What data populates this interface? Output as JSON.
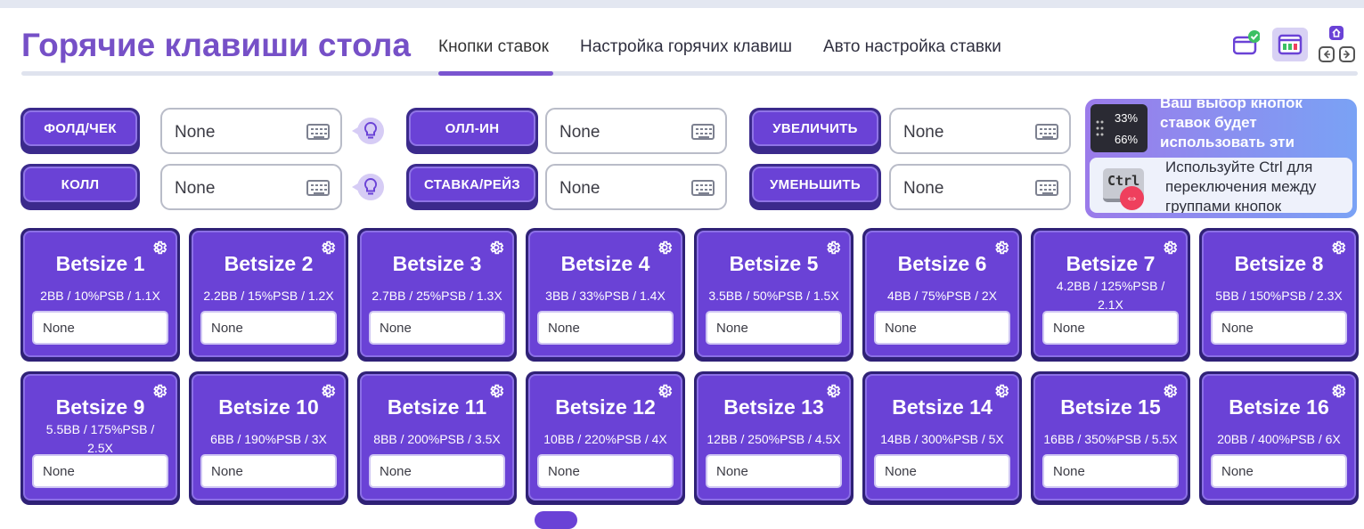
{
  "header": {
    "title": "Горячие клавиши стола",
    "tabs": [
      {
        "label": "Кнопки ставок",
        "active": true
      },
      {
        "label": "Настройка горячих клавиш",
        "active": false
      },
      {
        "label": "Авто настройка ставки",
        "active": false
      }
    ]
  },
  "actions": {
    "fold_check": {
      "label": "ФОЛД/ЧЕК",
      "value": "None"
    },
    "call": {
      "label": "КОЛЛ",
      "value": "None"
    },
    "all_in": {
      "label": "ОЛЛ-ИН",
      "value": "None"
    },
    "bet_raise": {
      "label": "СТАВКА/РЕЙЗ",
      "value": "None"
    },
    "increase": {
      "label": "УВЕЛИЧИТЬ",
      "value": "None"
    },
    "decrease": {
      "label": "УМЕНЬШИТЬ",
      "value": "None"
    }
  },
  "tips": {
    "pct_top": "33%",
    "pct_bottom": "66%",
    "tip1_text": "Ваш выбор кнопок ставок будет использовать эти",
    "ctrl_key": "Ctrl",
    "tip2_text": "Используйте Ctrl для переключения между группами кнопок"
  },
  "betsizes": [
    {
      "name": "Betsize 1",
      "desc": "2BB / 10%PSB / 1.1X",
      "value": "None"
    },
    {
      "name": "Betsize 2",
      "desc": "2.2BB / 15%PSB / 1.2X",
      "value": "None"
    },
    {
      "name": "Betsize 3",
      "desc": "2.7BB / 25%PSB / 1.3X",
      "value": "None"
    },
    {
      "name": "Betsize 4",
      "desc": "3BB / 33%PSB / 1.4X",
      "value": "None"
    },
    {
      "name": "Betsize 5",
      "desc": "3.5BB / 50%PSB / 1.5X",
      "value": "None"
    },
    {
      "name": "Betsize 6",
      "desc": "4BB / 75%PSB / 2X",
      "value": "None"
    },
    {
      "name": "Betsize 7",
      "desc": "4.2BB / 125%PSB / 2.1X",
      "value": "None"
    },
    {
      "name": "Betsize 8",
      "desc": "5BB / 150%PSB / 2.3X",
      "value": "None"
    },
    {
      "name": "Betsize 9",
      "desc": "5.5BB / 175%PSB / 2.5X",
      "value": "None"
    },
    {
      "name": "Betsize 10",
      "desc": "6BB / 190%PSB / 3X",
      "value": "None"
    },
    {
      "name": "Betsize 11",
      "desc": "8BB / 200%PSB / 3.5X",
      "value": "None"
    },
    {
      "name": "Betsize 12",
      "desc": "10BB / 220%PSB / 4X",
      "value": "None"
    },
    {
      "name": "Betsize 13",
      "desc": "12BB / 250%PSB / 4.5X",
      "value": "None"
    },
    {
      "name": "Betsize 14",
      "desc": "14BB / 300%PSB / 5X",
      "value": "None"
    },
    {
      "name": "Betsize 15",
      "desc": "16BB / 350%PSB / 5.5X",
      "value": "None"
    },
    {
      "name": "Betsize 16",
      "desc": "20BB / 400%PSB / 6X",
      "value": "None"
    }
  ],
  "colors": {
    "accent": "#7650c7",
    "button": "#6a42d6",
    "button_shadow": "#2f2176",
    "success": "#3cc063"
  },
  "icons": [
    "window-check-icon",
    "layout-icon",
    "home-icon",
    "arrow-left-icon",
    "arrow-right-icon",
    "keyboard-icon",
    "bulb-icon",
    "gear-icon",
    "swap-icon"
  ]
}
